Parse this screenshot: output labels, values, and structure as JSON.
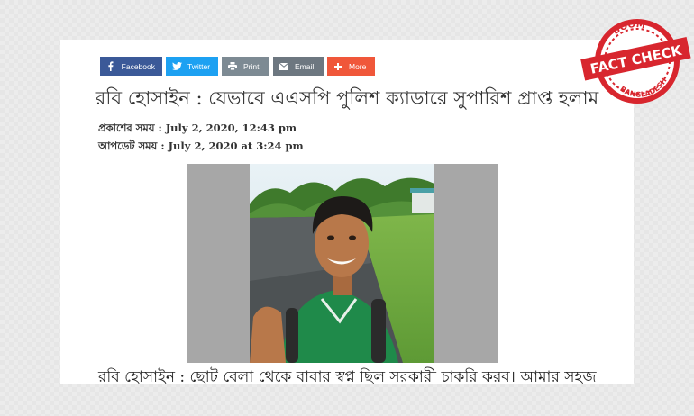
{
  "share_bar": {
    "facebook": "Facebook",
    "twitter": "Twitter",
    "print": "Print",
    "email": "Email",
    "more": "More"
  },
  "article": {
    "headline": "রবি হোসাইন : যেভাবে এএসপি পুলিশ ক্যাডারে সুপারিশ প্রাপ্ত হলাম",
    "published": "প্রকাশের সময় : July 2, 2020, 12:43 pm",
    "updated": "আপডেট সময় : July 2, 2020 at 3:24 pm",
    "body_start": "রবি হোসাইন : ছোট বেলা থেকে বাবার স্বপ্ন ছিল সরকারী চাকরি করব। আমার সহজ"
  },
  "badge": {
    "top": "BOOM",
    "middle": "FACT CHECK",
    "bottom": "BANGLADESH"
  },
  "colors": {
    "facebook": "#3b5998",
    "twitter": "#1da1f2",
    "print": "#7d8a93",
    "email": "#6d7780",
    "more": "#f0573a",
    "badge_red": "#d8262e"
  }
}
